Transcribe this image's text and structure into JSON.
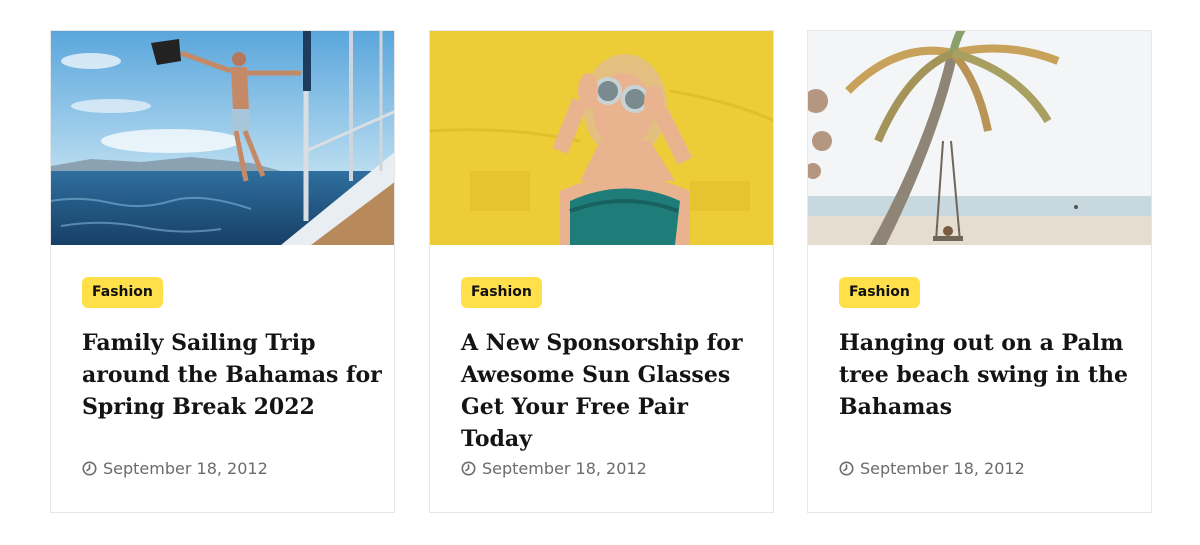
{
  "colors": {
    "badge_bg": "#ffe04b",
    "border": "#e6e6e6",
    "title": "#141414",
    "meta": "#6b6b6b"
  },
  "posts": [
    {
      "image": "sailing-man-on-boat-photo",
      "category": "Fashion",
      "title": "Family Sailing Trip around the Bahamas for Spring Break 2022",
      "date_icon": "clock-icon",
      "date": "September 18, 2012"
    },
    {
      "image": "woman-with-sunglasses-yellow-wall-photo",
      "category": "Fashion",
      "title": "A New Sponsorship for Awesome Sun Glasses Get Your Free Pair Today",
      "date_icon": "clock-icon",
      "date": "September 18, 2012"
    },
    {
      "image": "palm-tree-beach-swing-photo",
      "category": "Fashion",
      "title": "Hanging out on a Palm tree beach swing in the Bahamas",
      "date_icon": "clock-icon",
      "date": "September 18, 2012"
    }
  ]
}
